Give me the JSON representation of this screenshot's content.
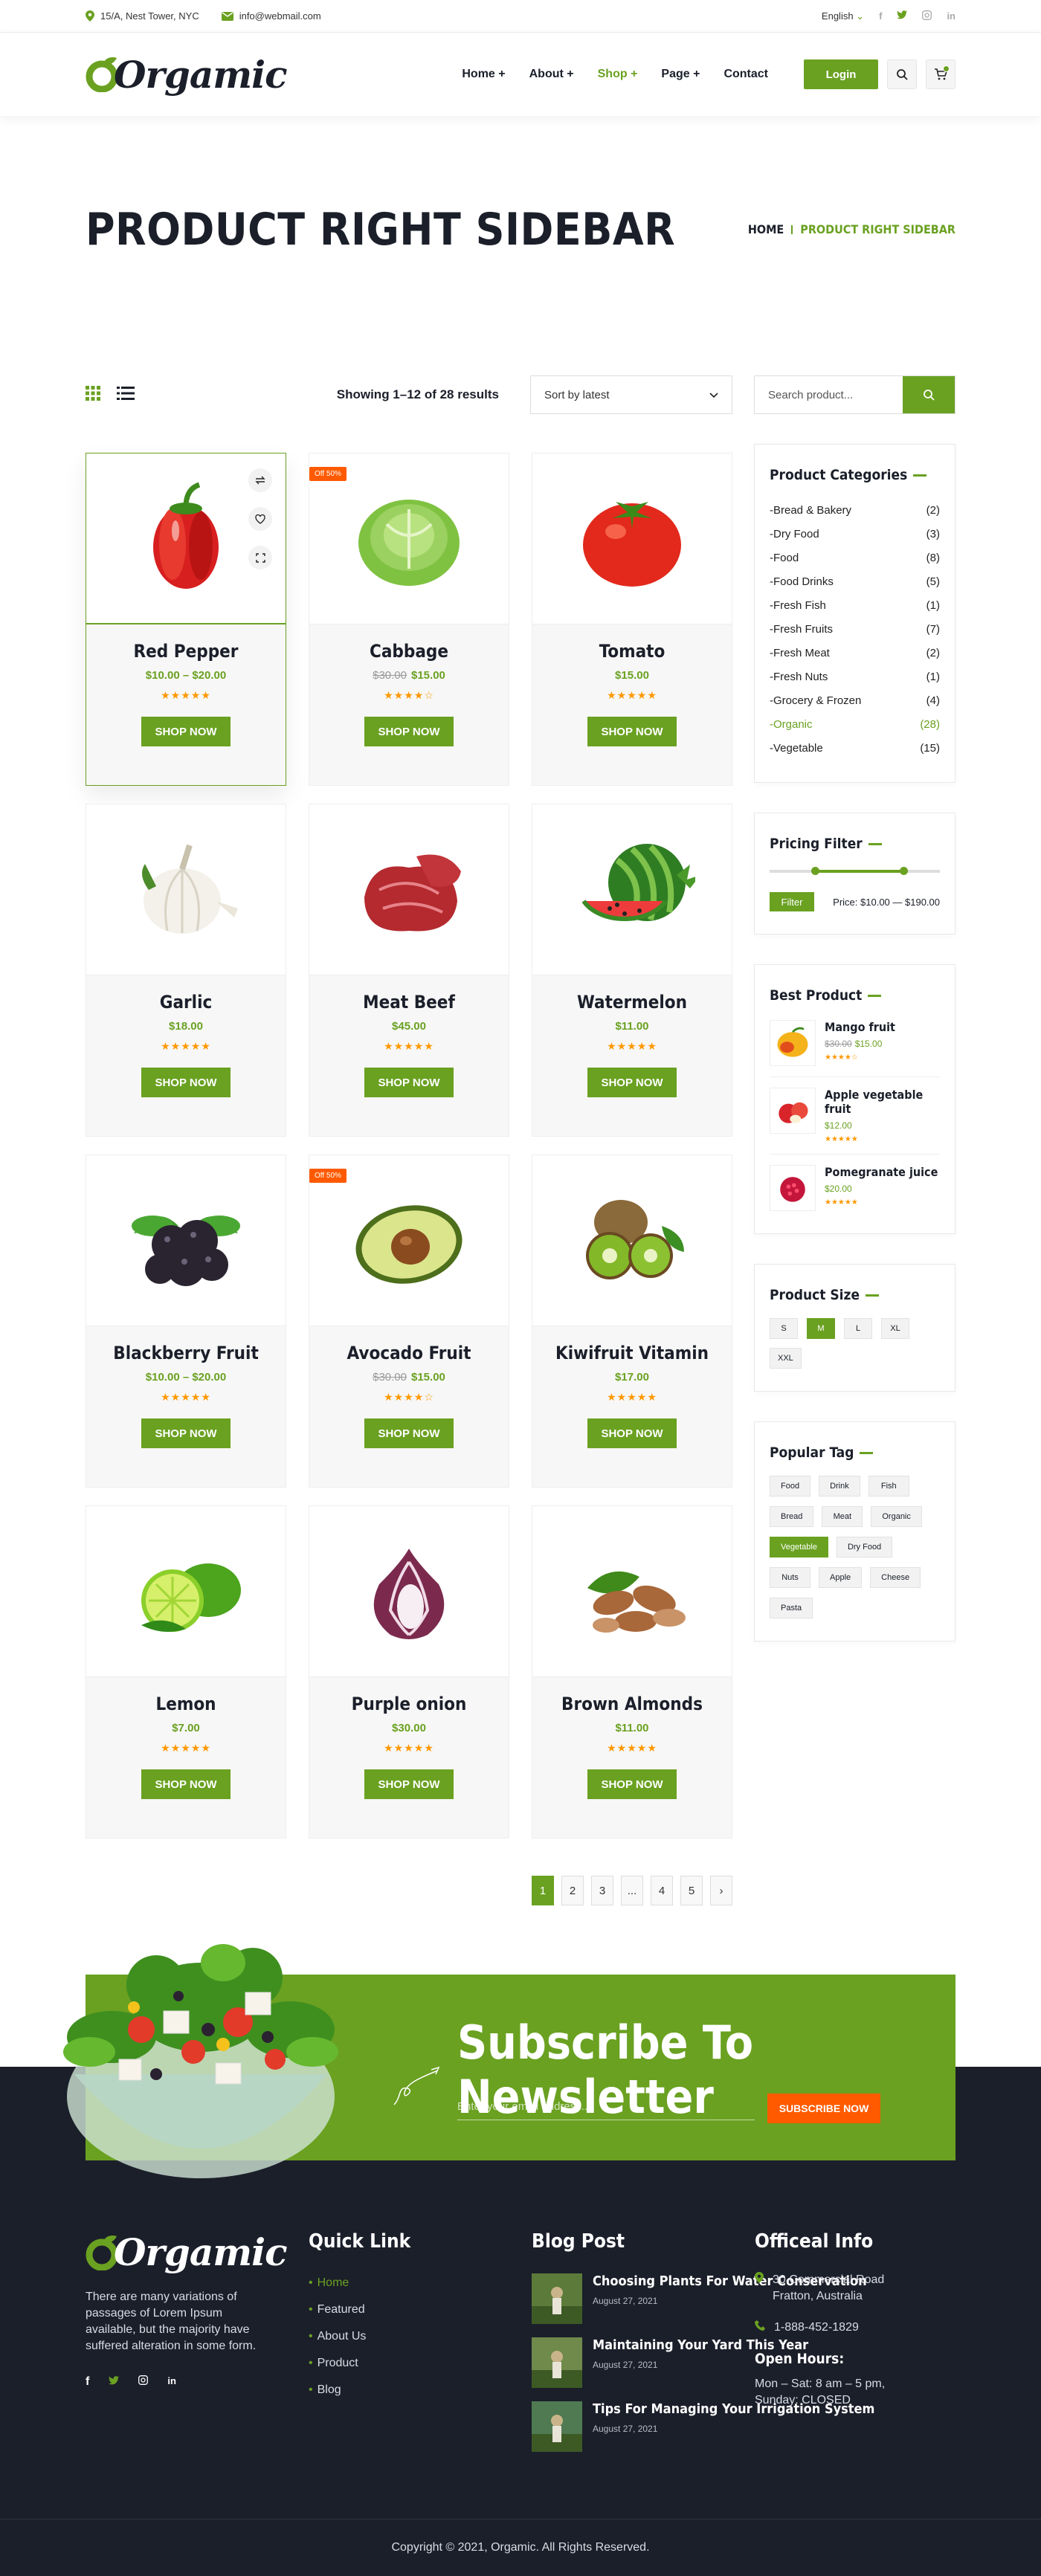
{
  "topbar": {
    "address": "15/A, Nest Tower, NYC",
    "email": "info@webmail.com",
    "language": "English"
  },
  "header": {
    "logo": "Orgamic",
    "nav": [
      {
        "label": "Home +"
      },
      {
        "label": "About +"
      },
      {
        "label": "Shop +",
        "active": true
      },
      {
        "label": "Page +"
      },
      {
        "label": "Contact"
      }
    ],
    "login": "Login"
  },
  "page": {
    "title": "PRODUCT RIGHT SIDEBAR",
    "crumb_home": "HOME",
    "crumb_current": "PRODUCT RIGHT SIDEBAR"
  },
  "toolbar": {
    "results": "Showing 1–12 of 28 results",
    "sort": "Sort by latest"
  },
  "products": [
    {
      "name": "Red Pepper",
      "price": "$10.00 – $20.00",
      "old": "",
      "rating": 5,
      "badge": "",
      "icon": "pepper"
    },
    {
      "name": "Cabbage",
      "price": "$15.00",
      "old": "$30.00",
      "rating": 4,
      "badge": "Off 50%",
      "icon": "cabbage"
    },
    {
      "name": "Tomato",
      "price": "$15.00",
      "old": "",
      "rating": 5,
      "badge": "",
      "icon": "tomato"
    },
    {
      "name": "Garlic",
      "price": "$18.00",
      "old": "",
      "rating": 5,
      "badge": "",
      "icon": "garlic"
    },
    {
      "name": "Meat Beef",
      "price": "$45.00",
      "old": "",
      "rating": 5,
      "badge": "",
      "icon": "meat"
    },
    {
      "name": "Watermelon",
      "price": "$11.00",
      "old": "",
      "rating": 5,
      "badge": "",
      "icon": "watermelon"
    },
    {
      "name": "Blackberry Fruit",
      "price": "$10.00 – $20.00",
      "old": "",
      "rating": 5,
      "badge": "",
      "icon": "blackberry"
    },
    {
      "name": "Avocado Fruit",
      "price": "$15.00",
      "old": "$30.00",
      "rating": 4,
      "badge": "Off 50%",
      "icon": "avocado"
    },
    {
      "name": "Kiwifruit Vitamin",
      "price": "$17.00",
      "old": "",
      "rating": 5,
      "badge": "",
      "icon": "kiwi"
    },
    {
      "name": "Lemon",
      "price": "$7.00",
      "old": "",
      "rating": 5,
      "badge": "",
      "icon": "lemon"
    },
    {
      "name": "Purple onion",
      "price": "$30.00",
      "old": "",
      "rating": 5,
      "badge": "",
      "icon": "onion"
    },
    {
      "name": "Brown Almonds",
      "price": "$11.00",
      "old": "",
      "rating": 5,
      "badge": "",
      "icon": "almond"
    }
  ],
  "shop_now": "SHOP NOW",
  "pagination": [
    "1",
    "2",
    "3",
    "...",
    "4",
    "5",
    "›"
  ],
  "sidebar": {
    "search_placeholder": "Search product...",
    "categories_title": "Product Categories",
    "categories": [
      {
        "name": "-Bread & Bakery",
        "count": "(2)"
      },
      {
        "name": "-Dry Food",
        "count": "(3)"
      },
      {
        "name": "-Food",
        "count": "(8)"
      },
      {
        "name": "-Food Drinks",
        "count": "(5)"
      },
      {
        "name": "-Fresh Fish",
        "count": "(1)"
      },
      {
        "name": "-Fresh Fruits",
        "count": "(7)"
      },
      {
        "name": "-Fresh Meat",
        "count": "(2)"
      },
      {
        "name": "-Fresh Nuts",
        "count": "(1)"
      },
      {
        "name": "-Grocery & Frozen",
        "count": "(4)"
      },
      {
        "name": "-Organic",
        "count": "(28)",
        "active": true
      },
      {
        "name": "-Vegetable",
        "count": "(15)"
      }
    ],
    "pricing_title": "Pricing Filter",
    "filter_btn": "Filter",
    "price_text": "Price: $10.00 — $190.00",
    "best_title": "Best Product",
    "best": [
      {
        "name": "Mango fruit",
        "old": "$30.00",
        "price": "$15.00",
        "rating": 4
      },
      {
        "name": "Apple vegetable fruit",
        "old": "",
        "price": "$12.00",
        "rating": 5
      },
      {
        "name": "Pomegranate juice",
        "old": "",
        "price": "$20.00",
        "rating": 5
      }
    ],
    "size_title": "Product Size",
    "sizes": [
      "S",
      "M",
      "L",
      "XL",
      "XXL"
    ],
    "size_active": "M",
    "tag_title": "Popular Tag",
    "tags": [
      "Food",
      "Drink",
      "Fish",
      "Bread",
      "Meat",
      "Organic",
      "Vegetable",
      "Dry Food",
      "Nuts",
      "Apple",
      "Cheese",
      "Pasta"
    ],
    "tag_active": "Vegetable"
  },
  "newsletter": {
    "title": "Subscribe To Newsletter",
    "placeholder": "Enter your email address...",
    "button": "SUBSCRIBE NOW"
  },
  "footer": {
    "desc": "There are many variations of passages of Lorem Ipsum available, but the majority have suffered alteration in some form.",
    "quick_title": "Quick Link",
    "quick": [
      "Home",
      "Featured",
      "About Us",
      "Product",
      "Blog"
    ],
    "blog_title": "Blog Post",
    "posts": [
      {
        "title": "Choosing Plants For Water Conservation",
        "date": "August 27, 2021"
      },
      {
        "title": "Maintaining Your Yard This Year",
        "date": "August 27, 2021"
      },
      {
        "title": "Tips For Managing Your Irrigation System",
        "date": "August 27, 2021"
      }
    ],
    "info_title": "Officeal Info",
    "address": "30 Commercial Road Fratton, Australia",
    "phone": "1-888-452-1829",
    "hours_title": "Open Hours:",
    "hours": "Mon – Sat: 8 am – 5 pm, Sunday: CLOSED",
    "copyright": "Copyright © 2021, Orgamic. All Rights Reserved."
  },
  "colors": {
    "accent": "#6aa121",
    "dark": "#1b1f2a",
    "badge": "#ff5a00",
    "star": "#ff9800"
  }
}
